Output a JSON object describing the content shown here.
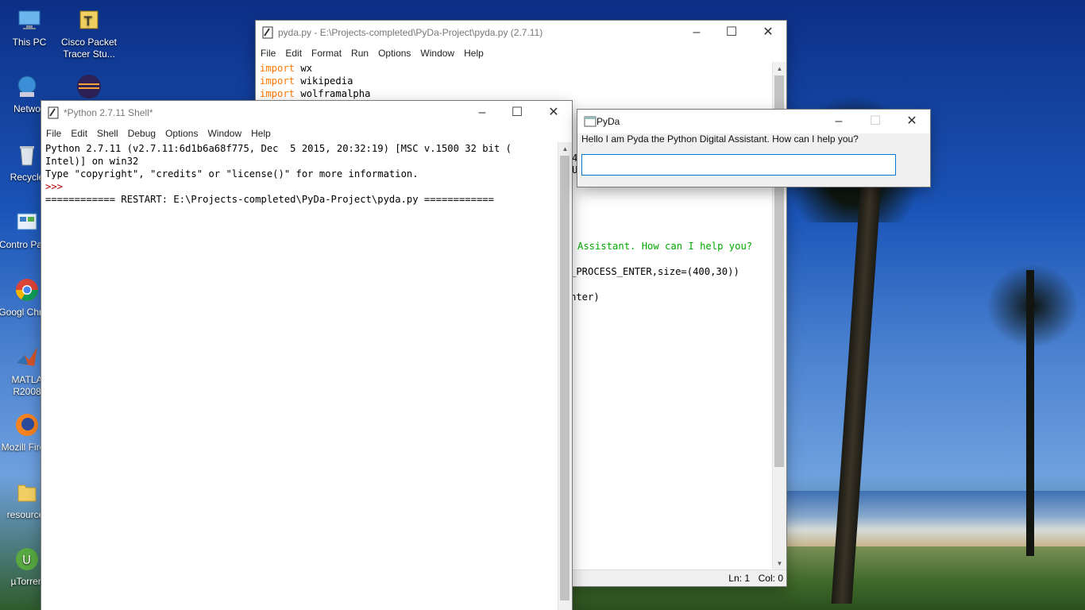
{
  "desktop": {
    "icons": [
      {
        "label": "This PC",
        "icon": "this-pc-icon"
      },
      {
        "label": "Cisco Packet Tracer Stu...",
        "icon": "cisco-packet-tracer-icon"
      },
      {
        "label": "Netwo",
        "icon": "network-icon"
      },
      {
        "label": "",
        "icon": "eclipse-icon"
      },
      {
        "label": "Recycle",
        "icon": "recycle-bin-icon"
      },
      {
        "label": "Contro Panel",
        "icon": "control-panel-icon"
      },
      {
        "label": "Googl Chrom",
        "icon": "chrome-icon"
      },
      {
        "label": "MATLA R2008",
        "icon": "matlab-icon"
      },
      {
        "label": "Mozill Firefo",
        "icon": "firefox-icon"
      },
      {
        "label": "resource-",
        "icon": "folder-icon"
      },
      {
        "label": "µTorren",
        "icon": "utorrent-icon"
      }
    ]
  },
  "editor": {
    "title": "pyda.py - E:\\Projects-completed\\PyDa-Project\\pyda.py (2.7.11)",
    "menu": [
      "File",
      "Edit",
      "Format",
      "Run",
      "Options",
      "Window",
      "Help"
    ],
    "code": [
      {
        "kw": "import",
        "rest": " wx"
      },
      {
        "kw": "import",
        "rest": " wikipedia"
      },
      {
        "kw": "import",
        "rest": " wolframalpha"
      }
    ],
    "visible_fragments": {
      "f1": "4",
      "f2": "U",
      "greeting": "Assistant. How can I help you?",
      "line2": "_PROCESS_ENTER,size=(400,30))",
      "line3": "nter)"
    },
    "status": {
      "ln": "Ln: 1",
      "col": "Col: 0"
    }
  },
  "shell": {
    "title": "*Python 2.7.11 Shell*",
    "menu": [
      "File",
      "Edit",
      "Shell",
      "Debug",
      "Options",
      "Window",
      "Help"
    ],
    "lines": {
      "l1": "Python 2.7.11 (v2.7.11:6d1b6a68f775, Dec  5 2015, 20:32:19) [MSC v.1500 32 bit (",
      "l2": "Intel)] on win32",
      "l3": "Type \"copyright\", \"credits\" or \"license()\" for more information.",
      "prompt": ">>>",
      "l5": "============ RESTART: E:\\Projects-completed\\PyDa-Project\\pyda.py ============"
    }
  },
  "pyda": {
    "title": "PyDa",
    "message": "Hello I am Pyda the Python Digital Assistant. How can I help you?",
    "input_value": ""
  },
  "colors": {
    "keyword": "#ff7700",
    "string": "#00aa00",
    "prompt": "#b00000",
    "input_border": "#0078d7"
  }
}
